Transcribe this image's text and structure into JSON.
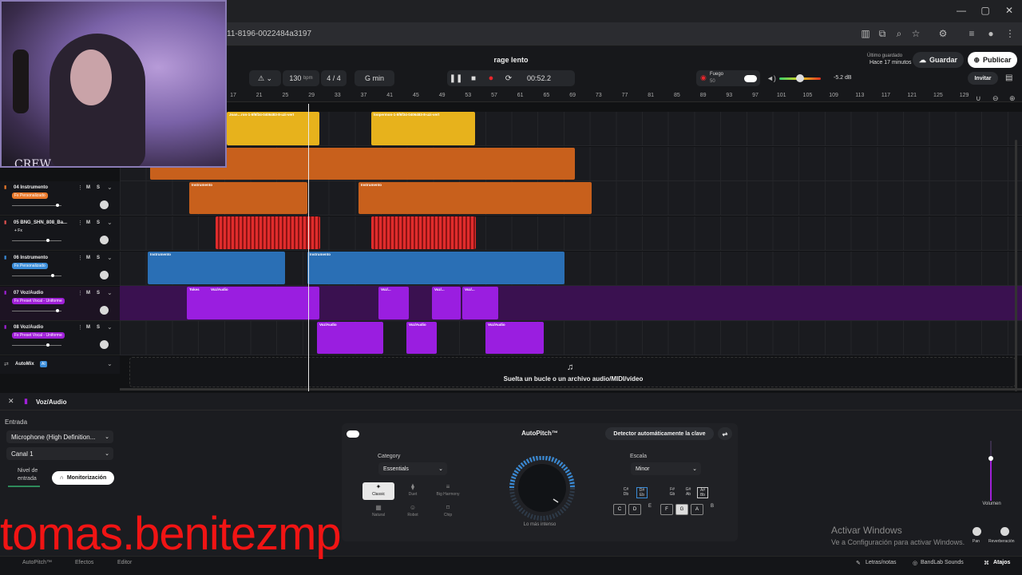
{
  "browser": {
    "url": "11-8196-0022484a3197"
  },
  "header": {
    "song_title": "rage lento",
    "bpm": "130",
    "bpm_unit": "bpm",
    "time_sig": "4 / 4",
    "key": "G min",
    "time": "00:52.2",
    "fuego_label": "Fuego",
    "fuego_value": "50",
    "master_db": "-5.2 dB",
    "saved_label": "Último guardado",
    "saved_time": "Hace 17 minutos",
    "save_button": "Guardar",
    "publish_button": "Publicar",
    "invite_button": "Invitar"
  },
  "ruler": {
    "ticks": [
      "17",
      "21",
      "25",
      "29",
      "33",
      "37",
      "41",
      "45",
      "49",
      "53",
      "57",
      "61",
      "65",
      "69",
      "73",
      "77",
      "81",
      "85",
      "89",
      "93",
      "97",
      "101",
      "105",
      "109",
      "113",
      "117",
      "121",
      "125",
      "129"
    ]
  },
  "tracks": [
    {
      "number": "",
      "name": "",
      "fx": "",
      "fx_color": "#f0c020"
    },
    {
      "number": "",
      "name": "",
      "fx": "",
      "fx_color": "#e07020"
    },
    {
      "number": "04",
      "name": "Instrumento",
      "fx": "Fx Personalizado",
      "fx_color": "#e8782a"
    },
    {
      "number": "05",
      "name": "BNG_SHN_808_Ba...",
      "fx": "+ Fx",
      "fx_color": "transparent"
    },
    {
      "number": "06",
      "name": "Instrumento",
      "fx": "Fx Personalizado",
      "fx_color": "#3a8cd8"
    },
    {
      "number": "07",
      "name": "Voz/Audio",
      "fx": "Fx Preset Vocal - Uniforme",
      "fx_color": "#a020d8"
    },
    {
      "number": "08",
      "name": "Voz/Audio",
      "fx": "Fx Preset Vocal - Uniforme",
      "fx_color": "#a020d8"
    }
  ],
  "mute_label": "M",
  "solo_label": "S",
  "clips": {
    "yellow_1": "Joan…ron-1-5f6f34-0406483-8-uzi-vert",
    "yellow_2": "loopermon-1-5f6f34-0406483-8-uzi-vert",
    "orange_lbl": "Instrumento",
    "blue_lbl": "Instrumento",
    "vocal_take": "Tokes",
    "vocal_lbl": "Voz/Audio",
    "vocal_short": "Voz/..."
  },
  "automix": {
    "label": "AutoMix",
    "badge": "AI"
  },
  "dropzone": "Suelta un bucle o un archivo audio/MIDI/vídeo",
  "panel": {
    "track_name": "Voz/Audio",
    "input_label": "Entrada",
    "input_device": "Microphone (High Definition...",
    "channel": "Canal 1",
    "level_label_1": "Nivel de",
    "level_label_2": "entrada",
    "monitor_button": "Monitorización"
  },
  "autopitch": {
    "title": "AutoPitch™",
    "detect_button": "Detector automáticamente la clave",
    "category_label": "Category",
    "category_value": "Essentials",
    "presets": [
      "Classic",
      "Duet",
      "Big Harmony",
      "Natural",
      "Robot",
      "Chip"
    ],
    "knob_caption": "Lo más intenso",
    "scale_label": "Escala",
    "scale_value": "Minor",
    "sharp_keys": [
      "C#\nDb",
      "D#\nEb",
      "F#\nGb",
      "G#\nAb",
      "A#\nBb"
    ],
    "keys": [
      "C",
      "D",
      "E",
      "F",
      "G",
      "A",
      "B"
    ]
  },
  "right_panel": {
    "volume_label": "Volumen",
    "pan_label": "Pan",
    "reverb_label": "Reverberación"
  },
  "footer": {
    "autopitch_tab": "AutoPitch™",
    "effects_tab": "Efectos",
    "editor_tab": "Editor",
    "lyrics": "Letras/notas",
    "sounds": "BandLab Sounds",
    "shortcuts": "Atajos"
  },
  "windows_activation": {
    "line1": "Activar Windows",
    "line2": "Ve a Configuración para activar Windows."
  },
  "webcam_text": "CREW",
  "overlay_name": "tomas.benitezmp"
}
